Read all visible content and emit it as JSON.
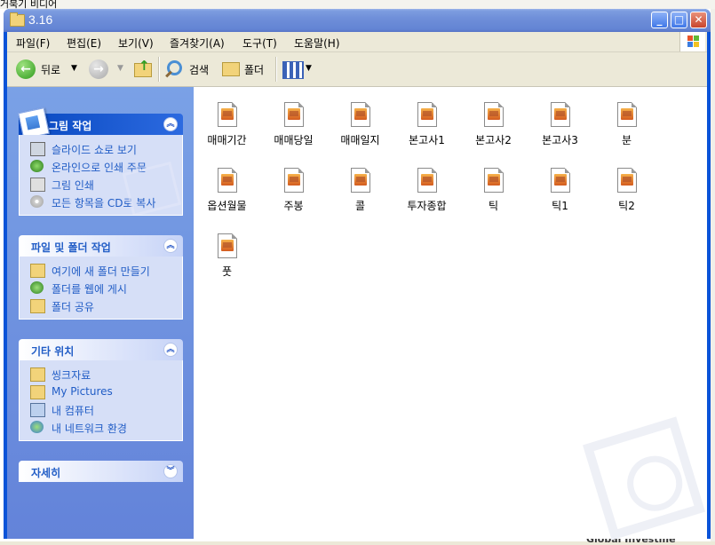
{
  "window": {
    "title": "3.16"
  },
  "menu": [
    "파일(F)",
    "편집(E)",
    "보기(V)",
    "즐겨찾기(A)",
    "도구(T)",
    "도움말(H)"
  ],
  "toolbar": {
    "back": "뒤로",
    "search": "검색",
    "folders": "폴더"
  },
  "panels": [
    {
      "title": "그림 작업",
      "items": [
        {
          "label": "슬라이드 쇼로 보기",
          "icon": "slideshow-icon"
        },
        {
          "label": "온라인으로 인쇄 주문",
          "icon": "online-print-icon"
        },
        {
          "label": "그림 인쇄",
          "icon": "printer-icon"
        },
        {
          "label": "모든 항목을 CD로 복사",
          "icon": "cd-copy-icon"
        }
      ]
    },
    {
      "title": "파일 및 폴더 작업",
      "items": [
        {
          "label": "여기에 새 폴더 만들기",
          "icon": "new-folder-icon"
        },
        {
          "label": "폴더를 웹에 게시",
          "icon": "web-publish-icon"
        },
        {
          "label": "폴더 공유",
          "icon": "share-folder-icon"
        }
      ]
    },
    {
      "title": "기타 위치",
      "items": [
        {
          "label": "씽크자료",
          "icon": "folder-icon"
        },
        {
          "label": "My Pictures",
          "icon": "folder-icon"
        },
        {
          "label": "내 컴퓨터",
          "icon": "computer-icon"
        },
        {
          "label": "내 네트워크 환경",
          "icon": "network-icon"
        }
      ]
    },
    {
      "title": "자세히",
      "items": []
    }
  ],
  "files": [
    "매매기간",
    "매매당일",
    "매매일지",
    "본고사1",
    "본고사2",
    "본고사3",
    "분",
    "옵션월물",
    "주봉",
    "콜",
    "투자종합",
    "틱",
    "틱1",
    "틱2",
    "풋"
  ],
  "colors": {
    "window_blue": "#0a53d8",
    "panel_link": "#215dc6",
    "taskpane": "#7aa1e6"
  },
  "behind": {
    "top_text": "거북기  비디어",
    "bottom_text": "Global Investme"
  }
}
